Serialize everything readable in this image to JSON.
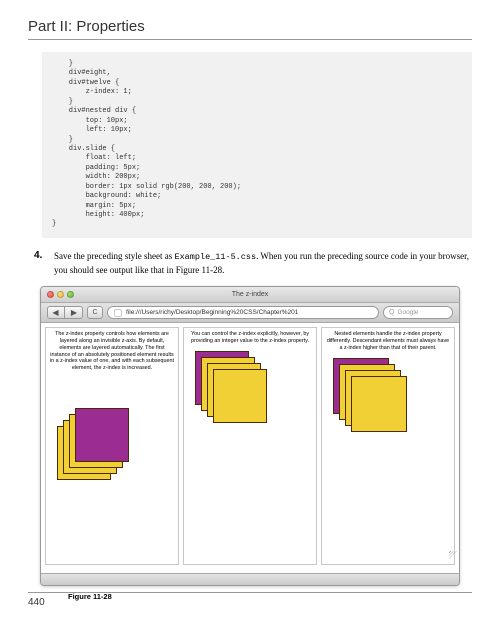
{
  "part_title": "Part II: Properties",
  "code": "    }\n    div#eight,\n    div#twelve {\n        z-index: 1;\n    }\n    div#nested div {\n        top: 10px;\n        left: 10px;\n    }\n    div.slide {\n        float: left;\n        padding: 5px;\n        width: 200px;\n        border: 1px solid rgb(200, 200, 200);\n        background: white;\n        margin: 5px;\n        height: 400px;\n}",
  "step": {
    "num": "4.",
    "pre": "Save the preceding style sheet as ",
    "filename": "Example_11-5.css",
    "post": ". When you run the preceding source code in your browser, you should see output like that in Figure 11-28."
  },
  "browser": {
    "window_title": "The z-index",
    "back": "◀",
    "fwd": "▶",
    "reload": "C",
    "url": "file:///Users/richy/Desktop/Beginning%20CSS/Chapter%201",
    "search_placeholder": "Google",
    "search_icon": "Q"
  },
  "slides": [
    "The z-index property controls how elements are layered along an invisible z-axis. By default, elements are layered automatically. The first instance of an absolutely positioned element results in a z-index value of one, and with each subsequent element, the z-index is increased.",
    "You can control the z-index explicitly, however, by providing an integer value to the z-index property.",
    "Nested elements handle the z-index property differently. Descendant elements must always have a z-index higher than that of their parent."
  ],
  "figure_caption": "Figure 11-28",
  "page_number": "440"
}
